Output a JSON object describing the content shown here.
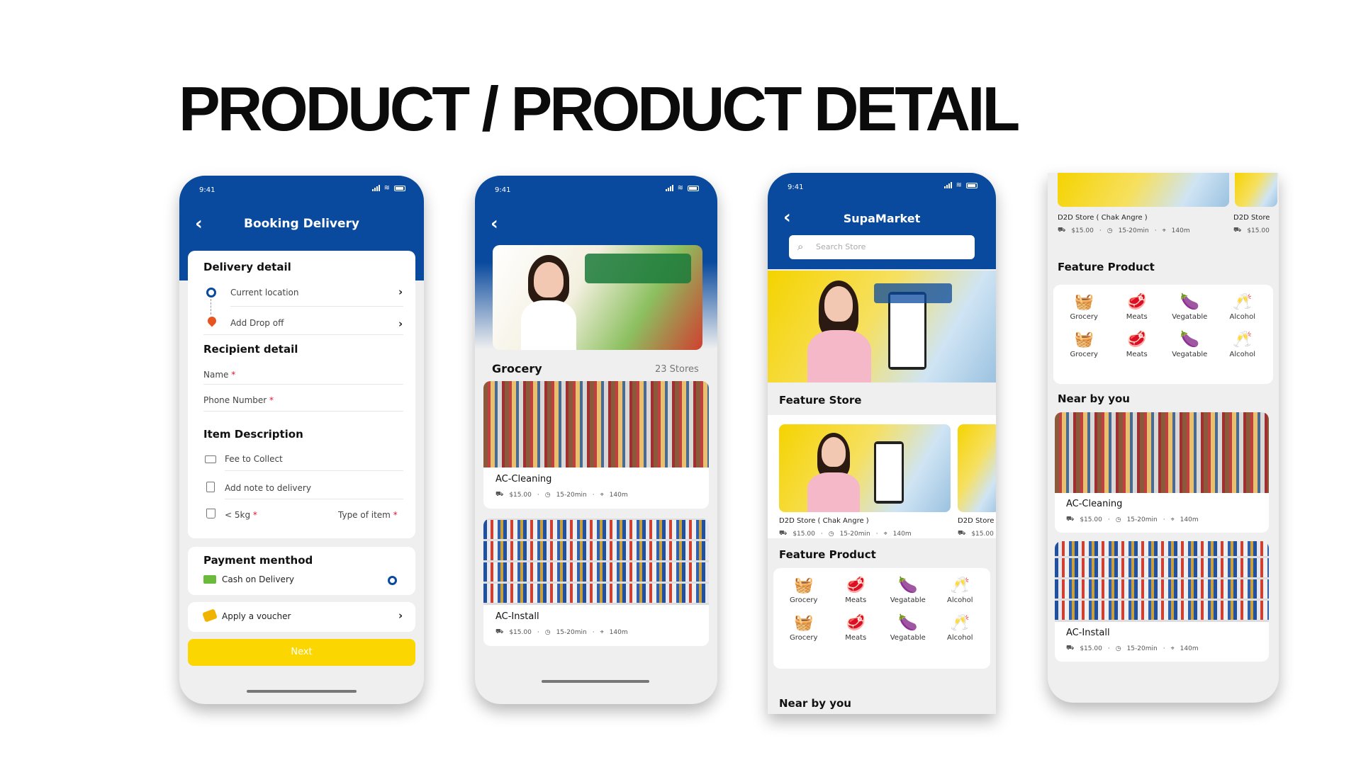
{
  "page_title": "PRODUCT / PRODUCT DETAIL",
  "status_time": "9:41",
  "booking": {
    "header": "Booking Delivery",
    "delivery_detail": "Delivery detail",
    "current_location": "Current location",
    "add_drop_off": "Add Drop off",
    "recipient_detail": "Recipient detail",
    "name": "Name",
    "phone": "Phone Number",
    "required": "*",
    "item_description": "Item Description",
    "fee": "Fee to Collect",
    "note": "Add note to delivery",
    "weight": "< 5kg",
    "type": "Type of item",
    "payment": "Payment menthod",
    "cash": "Cash on Delivery",
    "voucher": "Apply a voucher",
    "next": "Next"
  },
  "grocery": {
    "title": "Grocery",
    "count": "23 Stores",
    "items": [
      {
        "name": "AC-Cleaning",
        "price": "$15.00",
        "time": "15-20min",
        "dist": "140m"
      },
      {
        "name": "AC-Install",
        "price": "$15.00",
        "time": "15-20min",
        "dist": "140m"
      }
    ]
  },
  "market": {
    "header": "SupaMarket",
    "search_placeholder": "Search Store",
    "feature_store": "Feature Store",
    "store1": {
      "name": "D2D Store ( Chak Angre )",
      "price": "$15.00",
      "time": "15-20min",
      "dist": "140m"
    },
    "store2": {
      "name": "D2D Store",
      "price": "$15.00"
    },
    "feature_product": "Feature Product",
    "categories": [
      "Grocery",
      "Meats",
      "Vegatable",
      "Alcohol"
    ],
    "near_by": "Near by you"
  },
  "detail": {
    "store1": {
      "name": "D2D Store ( Chak Angre )",
      "price": "$15.00",
      "time": "15-20min",
      "dist": "140m"
    },
    "store2": {
      "name": "D2D Store",
      "price": "$15.00"
    },
    "feature_product": "Feature Product",
    "near_by": "Near by you",
    "items": [
      {
        "name": "AC-Cleaning",
        "price": "$15.00",
        "time": "15-20min",
        "dist": "140m"
      },
      {
        "name": "AC-Install",
        "price": "$15.00",
        "time": "15-20min",
        "dist": "140m"
      }
    ]
  },
  "icons": [
    "back-chevron-icon",
    "location-ring-icon",
    "pin-icon",
    "cash-icon",
    "note-icon",
    "bag-icon",
    "voucher-icon",
    "search-icon",
    "delivery-icon",
    "clock-icon",
    "distance-icon",
    "grocery-icon",
    "meat-icon",
    "vegetable-icon",
    "alcohol-icon"
  ],
  "colors": {
    "brand_blue": "#0a4a9e",
    "button_yellow": "#fbd600",
    "required_red": "#e0162b"
  }
}
